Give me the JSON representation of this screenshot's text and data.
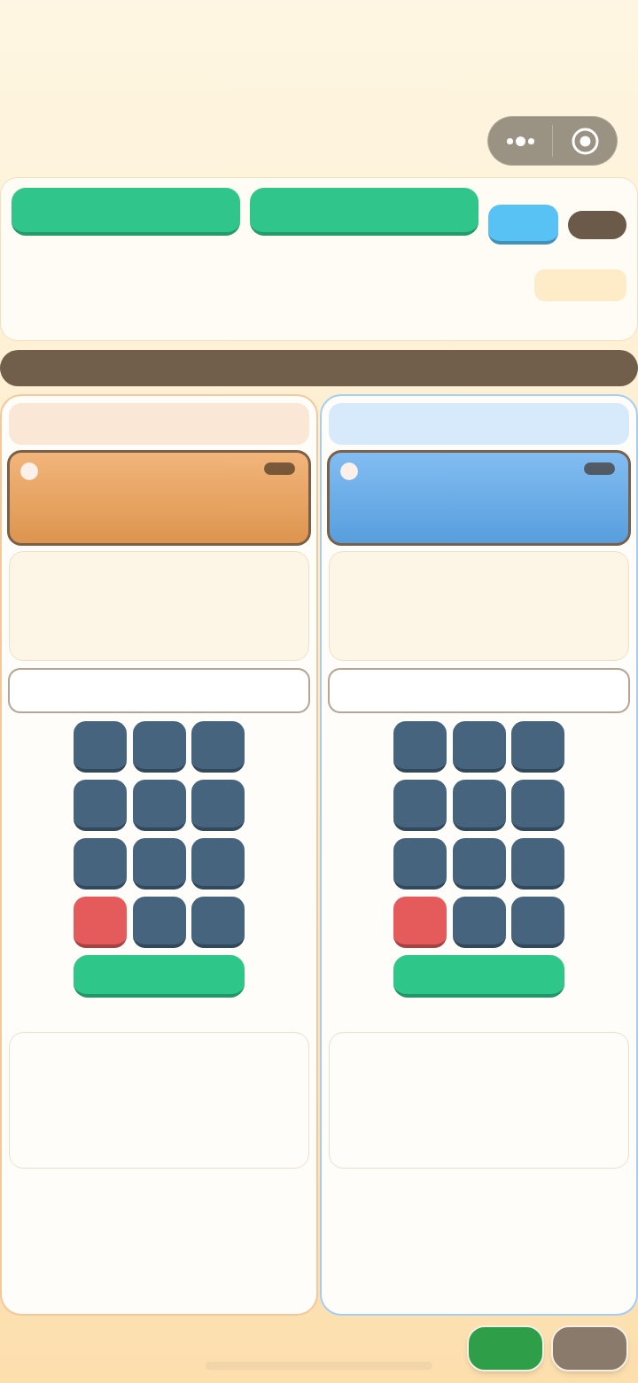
{
  "capsule": {
    "buttons": [
      {
        "kind": "dots"
      },
      {
        "kind": "ring"
      }
    ]
  },
  "toolbar": {
    "items": [
      {
        "kind": "wide",
        "color": "#30c68b"
      },
      {
        "kind": "wide",
        "color": "#30c68b"
      },
      {
        "kind": "small",
        "color": "#58c2f5"
      },
      {
        "kind": "pill",
        "color": "#6b5a4a"
      }
    ]
  },
  "panels": [
    {
      "color": "#eea055",
      "keys": [
        {
          "color": "#46647e"
        },
        {
          "color": "#46647e"
        },
        {
          "color": "#46647e"
        },
        {
          "color": "#46647e"
        },
        {
          "color": "#46647e"
        },
        {
          "color": "#46647e"
        },
        {
          "color": "#46647e"
        },
        {
          "color": "#46647e"
        },
        {
          "color": "#46647e"
        },
        {
          "color": "#e55b5b"
        },
        {
          "color": "#46647e"
        },
        {
          "color": "#46647e"
        }
      ]
    },
    {
      "color": "#5eaaee",
      "keys": [
        {
          "color": "#46647e"
        },
        {
          "color": "#46647e"
        },
        {
          "color": "#46647e"
        },
        {
          "color": "#46647e"
        },
        {
          "color": "#46647e"
        },
        {
          "color": "#46647e"
        },
        {
          "color": "#46647e"
        },
        {
          "color": "#46647e"
        },
        {
          "color": "#46647e"
        },
        {
          "color": "#e55b5b"
        },
        {
          "color": "#46647e"
        },
        {
          "color": "#46647e"
        }
      ]
    }
  ],
  "footer": {
    "buttons": [
      {
        "color": "#2e9e48"
      },
      {
        "color": "#8a7a6c"
      }
    ]
  }
}
